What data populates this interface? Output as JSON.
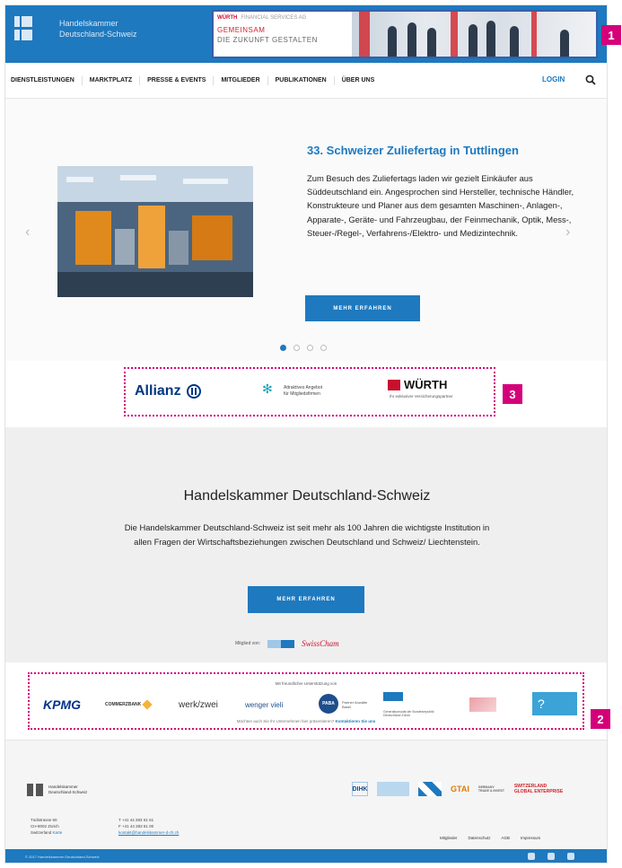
{
  "header": {
    "logo_line1": "Handelskammer",
    "logo_line2": "Deutschland-Schweiz",
    "ad": {
      "brand": "WÜRTH",
      "brand_sub": "FINANCIAL SERVICES AG",
      "line1": "GEMEINSAM",
      "line2": "DIE ZUKUNFT GESTALTEN"
    }
  },
  "nav": {
    "items": [
      "DIENSTLEISTUNGEN",
      "MARKTPLATZ",
      "PRESSE & EVENTS",
      "MITGLIEDER",
      "PUBLIKATIONEN",
      "ÜBER UNS"
    ],
    "login": "LOGIN"
  },
  "hero": {
    "title": "33. Schweizer Zuliefertag in Tuttlingen",
    "text": "Zum Besuch des Zuliefertags laden wir gezielt Einkäufer aus Süddeutschland ein. Angesprochen sind Hersteller, technische Händler, Konstrukteure und Planer aus dem gesamten Maschinen-, Anlagen-, Apparate-, Geräte- und Fahrzeugbau, der Feinmechanik, Optik, Mess-, Steuer-/Regel-, Verfahrens-/Elektro- und Medizintechnik.",
    "button": "MEHR ERFAHREN",
    "prev": "‹",
    "next": "›",
    "slide_count": 4,
    "active_slide": 1
  },
  "sponsors": {
    "allianz": "Allianz",
    "mid_line1": "Attraktives Angebot",
    "mid_line2": "für Mitgliedsfirmen",
    "wurth": "WÜRTH",
    "wurth_sub": "Ihr exklusiver Versicherungspartner"
  },
  "about": {
    "title": "Handelskammer Deutschland-Schweiz",
    "text": "Die Handelskammer Deutschland-Schweiz ist seit mehr als 100 Jahren die wichtigste Institution in allen Fragen der Wirtschaftsbeziehungen zwischen Deutschland und Schweiz/ Liechtenstein.",
    "button": "MEHR ERFAHREN",
    "member_label": "Mitglied von:",
    "member_logo2": "SwissCham"
  },
  "partners": {
    "heading": "Mit freundlicher Unterstützung von",
    "kpmg": "KPMG",
    "commerzbank": "COMMERZBANK",
    "werk": "werk/zwei",
    "wenger": "wenger vieli",
    "paba": "PABA",
    "paba_text": "Partner Anwälte Basel",
    "gc_text": "Generalkonsulat der Bundesrepublik Deutschland Zürich",
    "q": "?",
    "footer_text": "Möchten auch Sie Ihr Unternehmen hier präsentieren?",
    "footer_link": "Kontaktieren Sie uns"
  },
  "footer": {
    "logo_line1": "Handelskammer",
    "logo_line2": "Deutschland-Schweiz",
    "address": [
      "Tödistrasse 60",
      "CH-8002 Zürich",
      "Switzerland"
    ],
    "address_map": "Karte",
    "phone": "T +41 44 283 61 61",
    "fax": "F +41 44 283 61 00",
    "email": "kontakt@handelskammer-d-ch.ch",
    "logos": {
      "dihk": "DIHK",
      "gtai": "GTAI",
      "gtai_text": "GERMANY TRADE & INVEST",
      "swiss": "SWITZERLAND GLOBAL ENTERPRISE"
    },
    "links": [
      "Mitglieder",
      "Datenschutz",
      "AGB",
      "Impressum"
    ],
    "copyright": "© 2017 Handelskammer Deutschland-Schweiz"
  },
  "badges": [
    "1",
    "2",
    "3"
  ],
  "colors": {
    "brand": "#1e79bf",
    "highlight": "#d4007a"
  }
}
